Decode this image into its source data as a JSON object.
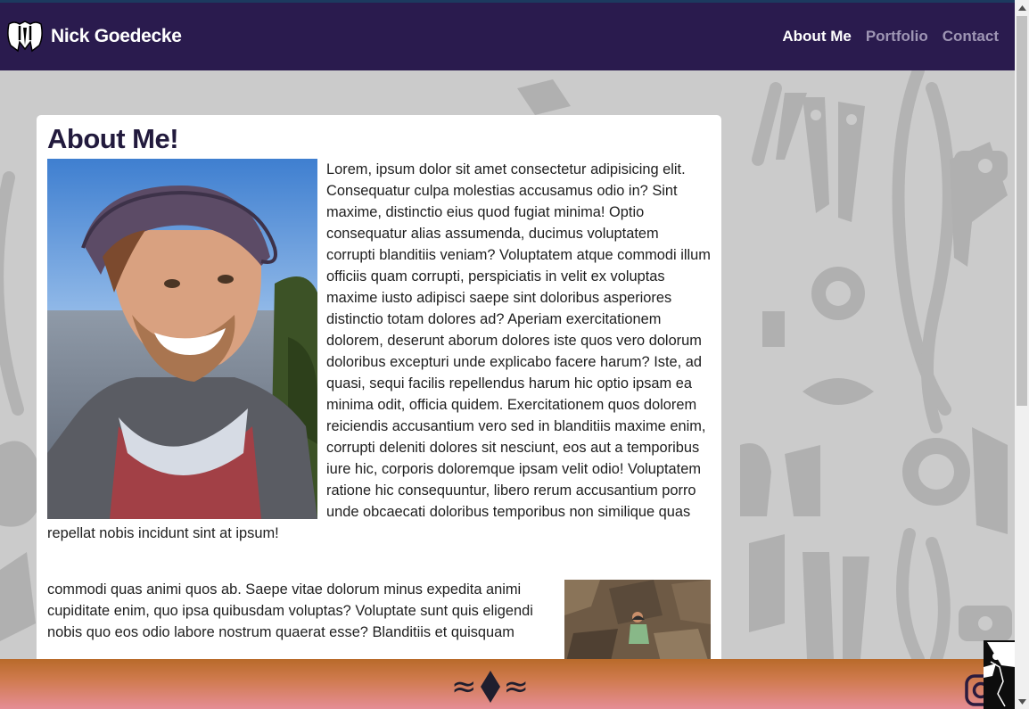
{
  "header": {
    "brand_name": "Nick Goedecke",
    "nav": [
      {
        "label": "About Me",
        "active": true
      },
      {
        "label": "Portfolio",
        "active": false
      },
      {
        "label": "Contact",
        "active": false
      }
    ]
  },
  "main": {
    "title": "About Me!",
    "paragraph1": "Lorem, ipsum dolor sit amet consectetur adipisicing elit. Consequatur culpa molestias accusamus odio in? Sint maxime, distinctio eius quod fugiat minima! Optio consequatur alias assumenda, ducimus voluptatem corrupti blanditiis veniam? Voluptatem atque commodi illum officiis quam corrupti, perspiciatis in velit ex voluptas maxime iusto adipisci saepe sint doloribus asperiores distinctio totam dolores ad? Aperiam exercitationem dolorem, deserunt aborum dolores iste quos vero dolorum doloribus excepturi unde explicabo facere harum? Iste, ad quasi, sequi facilis repellendus harum hic optio ipsam ea minima odit, officia quidem. Exercitationem quos dolorem reiciendis accusantium vero sed in blanditiis maxime enim, corrupti deleniti dolores sit nesciunt, eos aut a temporibus iure hic, corporis doloremque ipsam velit odio! Voluptatem ratione hic consequuntur, libero rerum accusantium porro unde obcaecati doloribus temporibus non similique quas repellat nobis incidunt sint at ipsum!",
    "paragraph2": "commodi quas animi quos ab. Saepe vitae dolorum minus expedita animi cupiditate enim, quo ipsa quibusdam voluptas? Voluptate sunt quis eligendi nobis quo eos odio labore nostrum quaerat esse? Blanditiis et quisquam"
  },
  "footer": {
    "ornament_left": "≈",
    "ornament_right": "≈"
  },
  "colors": {
    "navbar": "#2a1b4e",
    "nav_active": "#ffffff",
    "nav_inactive": "#9e95b4",
    "footer_top": "#b86a2a",
    "footer_bottom": "#e58d95"
  },
  "icons": {
    "brand": "elephant-logo-icon",
    "footer_center": "diamond-icon",
    "footer_right": "instagram-icon"
  }
}
